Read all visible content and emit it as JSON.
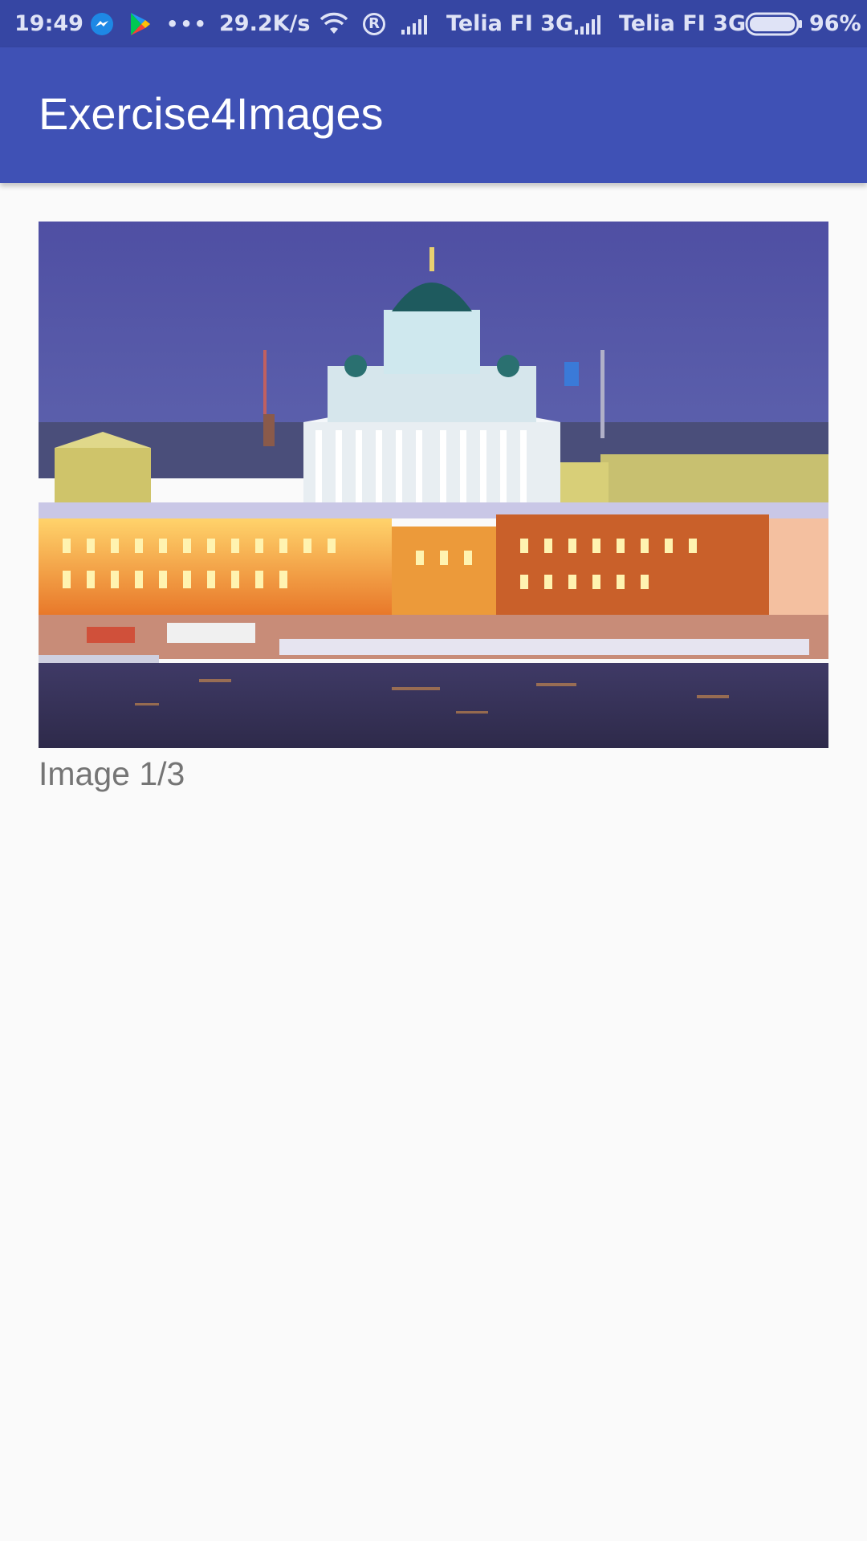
{
  "status_bar": {
    "time": "19:49",
    "overflow_dots": "•••",
    "network_speed": "29.2K/s",
    "carrier_1": "Telia FI 3G",
    "carrier_2": "Telia FI 3G",
    "battery_percent": "96%",
    "battery_level": 0.96,
    "roaming_glyph": "R",
    "icons": [
      "messenger-icon",
      "play-store-icon",
      "wifi-icon",
      "roaming-icon",
      "signal-icon",
      "battery-icon"
    ]
  },
  "app_bar": {
    "title": "Exercise4Images"
  },
  "image_view": {
    "caption": "Image 1/3",
    "current_index": 1,
    "total": 3
  },
  "colors": {
    "status_bar": "#3646a3",
    "app_bar": "#3f51b5",
    "background": "#fafafa",
    "caption_text": "#757575"
  }
}
